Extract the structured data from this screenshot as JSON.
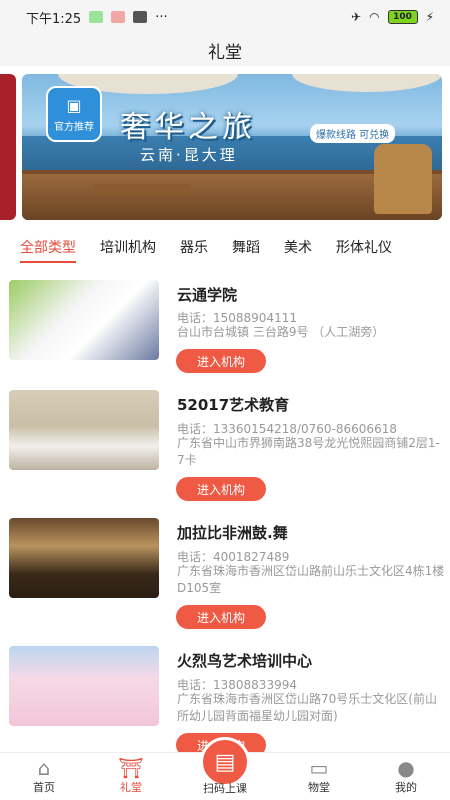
{
  "status_bar": {
    "time": "下午1:25",
    "battery": "100"
  },
  "header": {
    "title": "礼堂"
  },
  "banner": {
    "badge": "官方推荐",
    "title": "奢华之旅",
    "subtitle": "云南·昆大理",
    "tag": "爆款线路 可兑换"
  },
  "tabs": [
    {
      "label": "全部类型",
      "active": true
    },
    {
      "label": "培训机构"
    },
    {
      "label": "器乐"
    },
    {
      "label": "舞蹈"
    },
    {
      "label": "美术"
    },
    {
      "label": "形体礼仪"
    }
  ],
  "institutions": [
    {
      "name": "云通学院",
      "phone": "电话：15088904111",
      "address": "台山市台城镇 三台路9号 （人工湖旁）",
      "button": "进入机构"
    },
    {
      "name": "52017艺术教育",
      "phone": "电话：13360154218/0760-86606618",
      "address": "广东省中山市界狮南路38号龙光悦熙园商铺2层1-7卡",
      "button": "进入机构"
    },
    {
      "name": "加拉比非洲鼓.舞",
      "phone": "电话：4001827489",
      "address": "广东省珠海市香洲区岱山路前山乐士文化区4栋1楼D105室",
      "button": "进入机构"
    },
    {
      "name": "火烈鸟艺术培训中心",
      "phone": "电话：13808833994",
      "address": "广东省珠海市香洲区岱山路70号乐士文化区(前山所幼儿园背面福星幼儿园对面)",
      "button": "进入机构"
    }
  ],
  "bottom_nav": {
    "home": "首页",
    "hall": "礼堂",
    "scan": "扫码上课",
    "mall": "物堂",
    "mine": "我的"
  }
}
